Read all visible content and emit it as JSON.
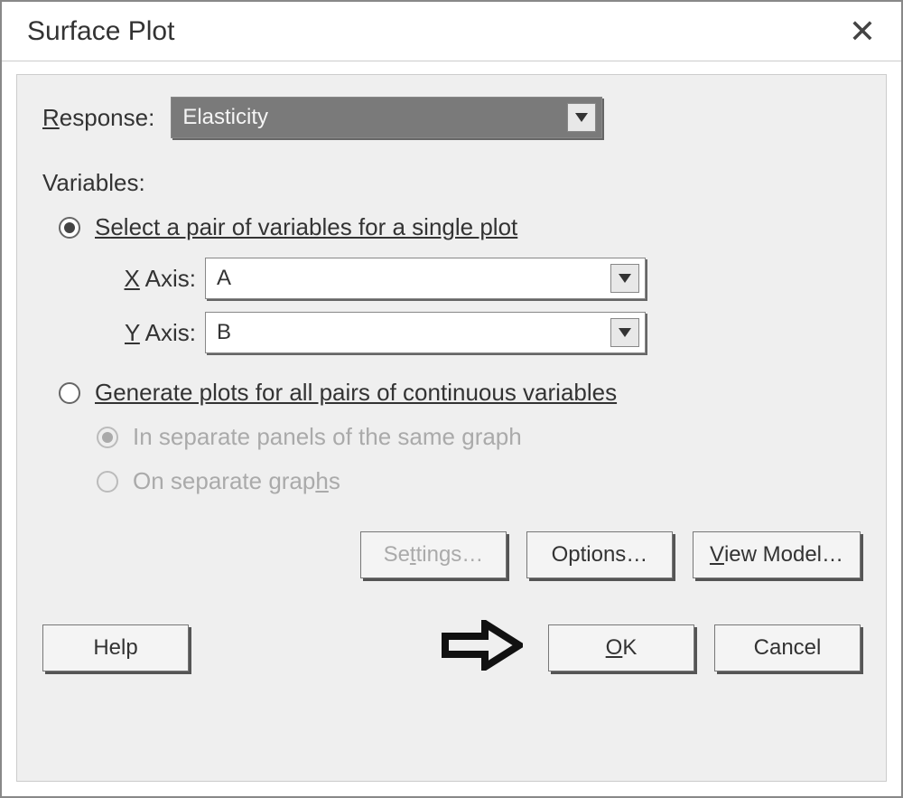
{
  "title": "Surface Plot",
  "response": {
    "label_pre": "R",
    "label_post": "esponse:",
    "value": "Elasticity"
  },
  "variables_label": "Variables:",
  "mode_single": {
    "selected": true,
    "label_pre": "S",
    "label_post": "elect a pair of variables for a single plot"
  },
  "axes": {
    "x": {
      "label_pre": "X",
      "label_post": " Axis:",
      "value": "A"
    },
    "y": {
      "label_pre": "Y",
      "label_post": " Axis:",
      "value": "B"
    }
  },
  "mode_all": {
    "selected": false,
    "label": "Generate plots for all pairs of continuous variables"
  },
  "sub_panels": {
    "selected": true,
    "label": "In separate panels of the same graph"
  },
  "sub_separate": {
    "selected": false,
    "label_pre": "On separate grap",
    "label_mid": "h",
    "label_post": "s"
  },
  "buttons": {
    "settings": {
      "pre": "Se",
      "mid": "t",
      "post": "tings…"
    },
    "options": "Options…",
    "viewmodel": {
      "pre": "V",
      "post": "iew Model…"
    },
    "help": "Help",
    "ok": {
      "pre": "O",
      "post": "K"
    },
    "cancel": "Cancel"
  }
}
